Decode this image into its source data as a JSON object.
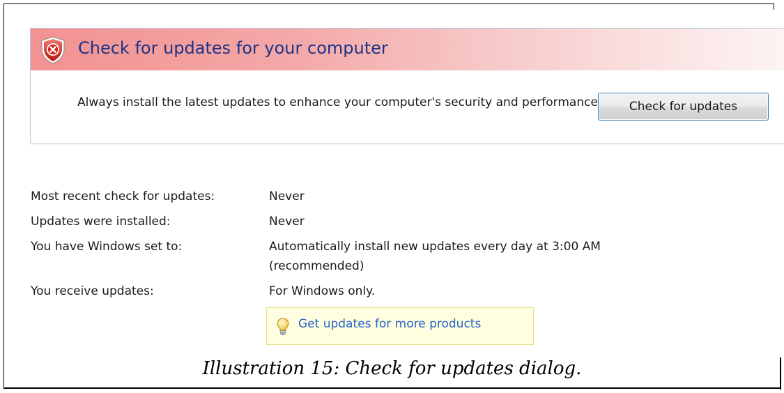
{
  "panel": {
    "title": "Check for updates for your computer",
    "description": "Always install the latest updates to enhance your computer's security and performance.",
    "button_label": "Check for updates",
    "header_color": "#f29291",
    "title_color": "#1e3287"
  },
  "info": {
    "rows": [
      {
        "label": "Most recent check for updates:",
        "value": "Never"
      },
      {
        "label": "Updates were installed:",
        "value": "Never"
      },
      {
        "label": "You have Windows set to:",
        "value": "Automatically install new updates every day at 3:00 AM (recommended)"
      },
      {
        "label": "You receive updates:",
        "value": "For Windows only."
      }
    ]
  },
  "more_products": {
    "link_label": "Get updates for more products",
    "icon": "lightbulb-icon",
    "link_color": "#2a63c8"
  },
  "caption": "Illustration 15: Check for updates dialog."
}
